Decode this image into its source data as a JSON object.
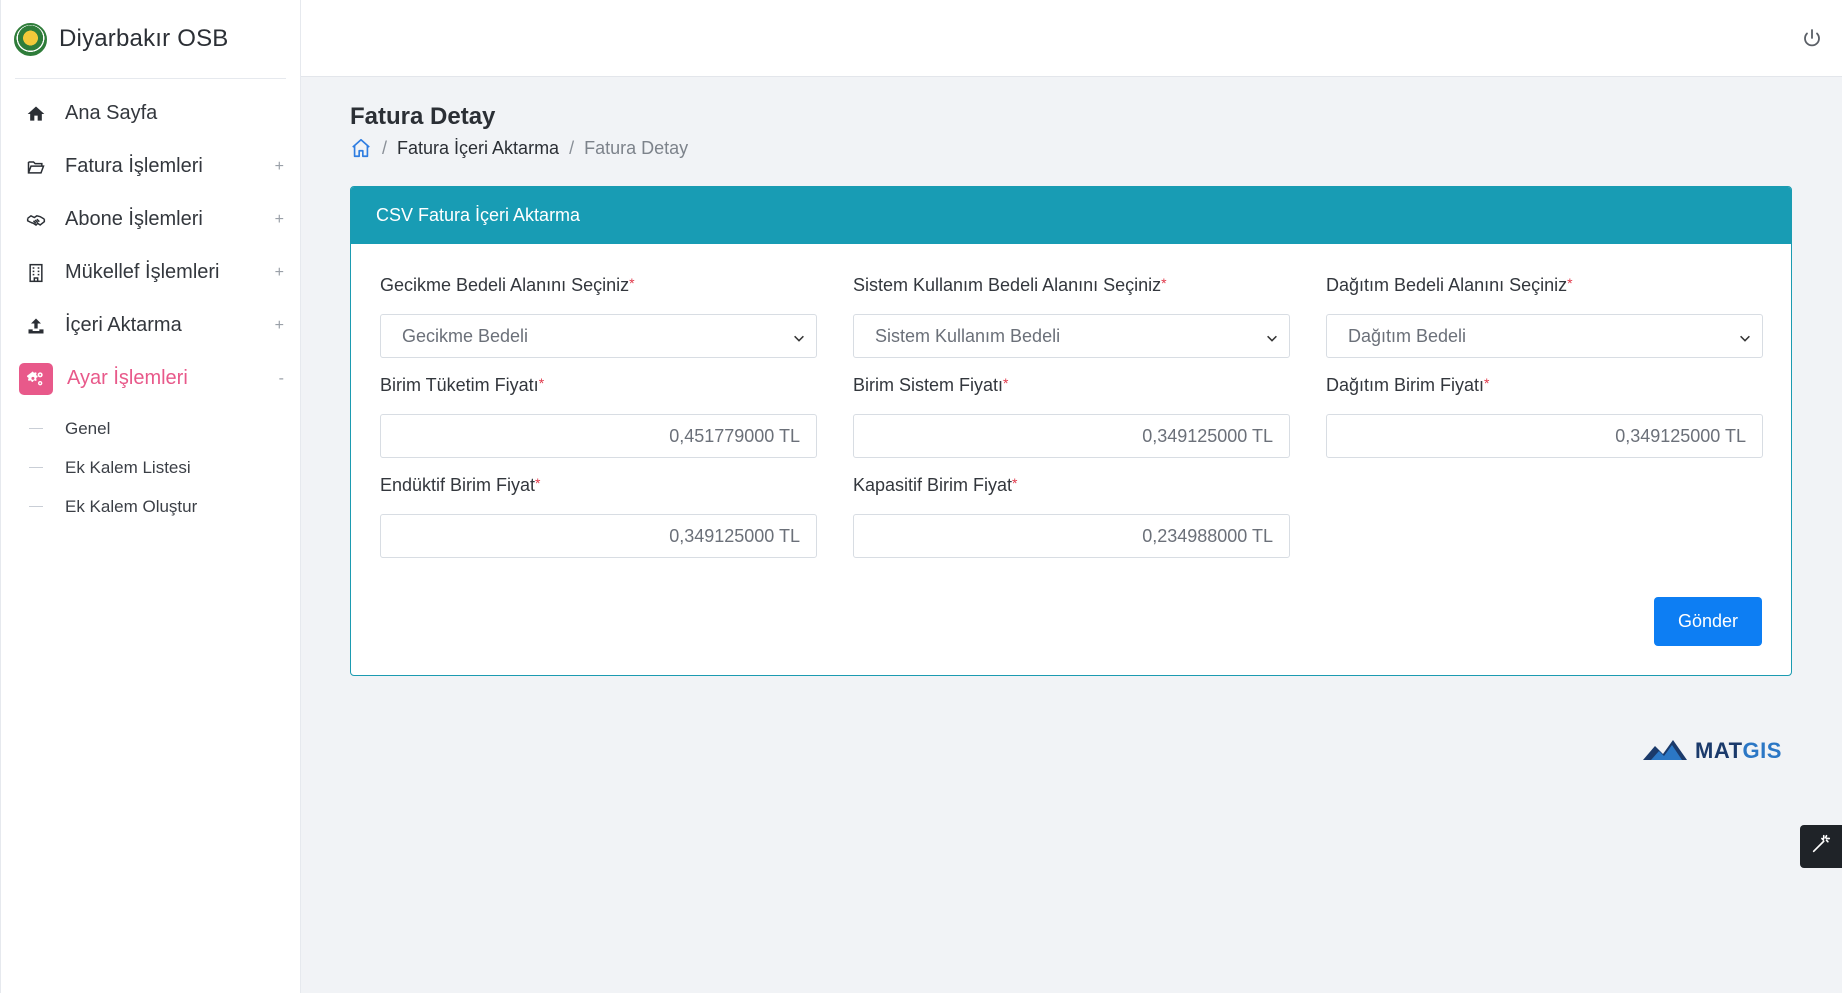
{
  "brand": {
    "name": "Diyarbakır OSB"
  },
  "sidebar": {
    "items": [
      {
        "label": "Ana Sayfa",
        "icon": "home-icon",
        "toggle": ""
      },
      {
        "label": "Fatura İşlemleri",
        "icon": "folder-open-icon",
        "toggle": "+"
      },
      {
        "label": "Abone İşlemleri",
        "icon": "handshake-icon",
        "toggle": "+"
      },
      {
        "label": "Mükellef İşlemleri",
        "icon": "building-icon",
        "toggle": "+"
      },
      {
        "label": "İçeri Aktarma",
        "icon": "upload-icon",
        "toggle": "+"
      },
      {
        "label": "Ayar İşlemleri",
        "icon": "cogs-icon",
        "toggle": "-"
      }
    ],
    "submenu": [
      {
        "label": "Genel"
      },
      {
        "label": "Ek Kalem Listesi"
      },
      {
        "label": "Ek Kalem Oluştur"
      }
    ],
    "active_color": "#e8598a"
  },
  "page": {
    "title": "Fatura Detay",
    "breadcrumb": {
      "link": "Fatura İçeri Aktarma",
      "current": "Fatura Detay",
      "separator": "/"
    }
  },
  "card": {
    "title": "CSV Fatura İçeri Aktarma",
    "header_color": "#189cb4",
    "required_mark": "*",
    "fields": {
      "gecikme_select": {
        "label": "Gecikme Bedeli Alanını Seçiniz",
        "value": "Gecikme Bedeli"
      },
      "sistem_select": {
        "label": "Sistem Kullanım Bedeli Alanını Seçiniz",
        "value": "Sistem Kullanım Bedeli"
      },
      "dagitim_select": {
        "label": "Dağıtım Bedeli Alanını Seçiniz",
        "value": "Dağıtım Bedeli"
      },
      "birim_tuketim": {
        "label": "Birim Tüketim Fiyatı",
        "value": "0,451779000 TL"
      },
      "birim_sistem": {
        "label": "Birim Sistem Fiyatı",
        "value": "0,349125000 TL"
      },
      "dagitim_birim": {
        "label": "Dağıtım Birim Fiyatı",
        "value": "0,349125000 TL"
      },
      "enduktif": {
        "label": "Endüktif Birim Fiyat",
        "value": "0,349125000 TL"
      },
      "kapasitif": {
        "label": "Kapasitif Birim Fiyat",
        "value": "0,234988000 TL"
      }
    },
    "submit_label": "Gönder",
    "submit_color": "#0d7ef3"
  },
  "footer": {
    "logo_mat": "MAT",
    "logo_gis": "GIS"
  }
}
